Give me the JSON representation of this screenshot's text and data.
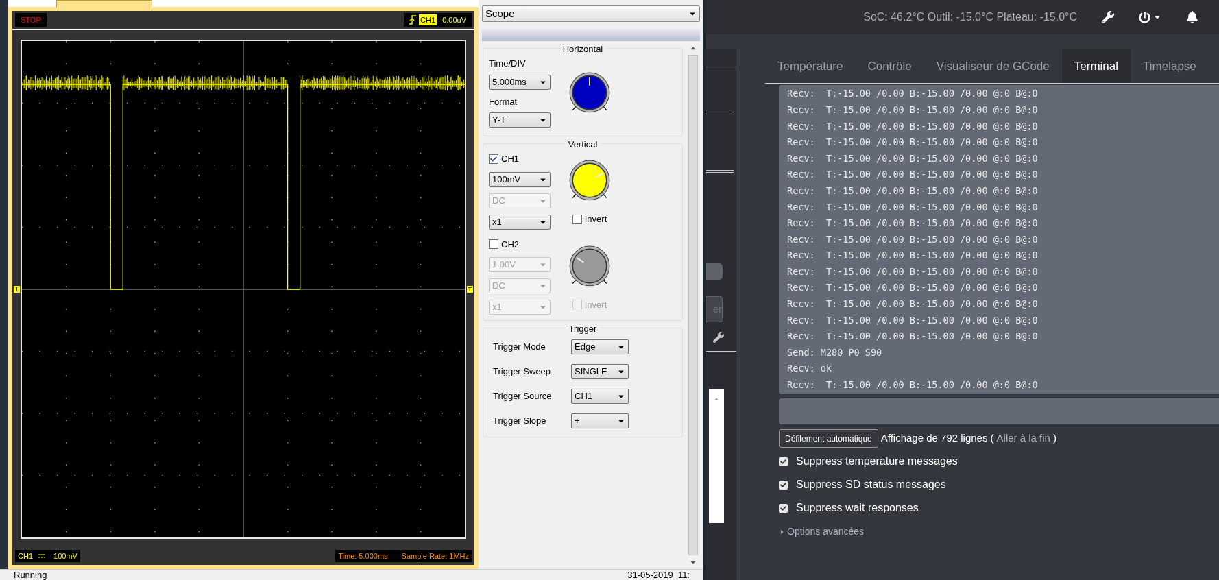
{
  "scope": {
    "status": "STOP",
    "trigger_channel": "CH1",
    "trigger_level": "0.00uV",
    "ground_marker": "1",
    "trigger_marker": "T",
    "footer_channel": "CH1",
    "footer_scale": "100mV",
    "time": "Time: 5.000ms",
    "sample_rate": "Sample Rate: 1MHz"
  },
  "panel": {
    "mode": "Scope",
    "horizontal": {
      "title": "Horizontal",
      "fields": [
        {
          "label": "Time/DIV",
          "value": "5.000ms"
        },
        {
          "label": "Format",
          "value": "Y-T"
        }
      ],
      "knob": {
        "color": "#0000c0"
      }
    },
    "vertical": {
      "title": "Vertical",
      "channels": [
        {
          "name": "CH1",
          "checked": true,
          "scale": "100mV",
          "coupling": "DC",
          "coupling_disabled": true,
          "probe": "x1",
          "invert": "Invert",
          "invert_checked": false,
          "knob": {
            "color": "#ffff00"
          }
        },
        {
          "name": "CH2",
          "checked": false,
          "scale": "1.00V",
          "coupling": "DC",
          "coupling_disabled": true,
          "probe": "x1",
          "invert": "Invert",
          "invert_checked": false,
          "knob": {
            "color": "#9a9a9a"
          }
        }
      ]
    },
    "trigger": {
      "title": "Trigger",
      "rows": [
        {
          "label": "Trigger Mode",
          "value": "Edge"
        },
        {
          "label": "Trigger Sweep",
          "value": "SINGLE"
        },
        {
          "label": "Trigger Source",
          "value": "CH1"
        },
        {
          "label": "Trigger Slope",
          "value": "+"
        }
      ]
    }
  },
  "status_bar": {
    "left": "Running",
    "right": "31-05-2019  11:"
  },
  "navbar": {
    "temperatures": "SoC: 46.2°C Outil: -15.0°C Plateau: -15.0°C"
  },
  "sidebar": {
    "button_fragment": "er"
  },
  "tabs": [
    {
      "label": "Température",
      "selected": false
    },
    {
      "label": "Contrôle",
      "selected": false
    },
    {
      "label": "Visualiseur de GCode",
      "selected": false
    },
    {
      "label": "Terminal",
      "selected": true
    },
    {
      "label": "Timelapse",
      "selected": false
    }
  ],
  "terminal": {
    "lines": [
      "Recv:  T:-15.00 /0.00 B:-15.00 /0.00 @:0 B@:0",
      "Recv:  T:-15.00 /0.00 B:-15.00 /0.00 @:0 B@:0",
      "Recv:  T:-15.00 /0.00 B:-15.00 /0.00 @:0 B@:0",
      "Recv:  T:-15.00 /0.00 B:-15.00 /0.00 @:0 B@:0",
      "Recv:  T:-15.00 /0.00 B:-15.00 /0.00 @:0 B@:0",
      "Recv:  T:-15.00 /0.00 B:-15.00 /0.00 @:0 B@:0",
      "Recv:  T:-15.00 /0.00 B:-15.00 /0.00 @:0 B@:0",
      "Recv:  T:-15.00 /0.00 B:-15.00 /0.00 @:0 B@:0",
      "Recv:  T:-15.00 /0.00 B:-15.00 /0.00 @:0 B@:0",
      "Recv:  T:-15.00 /0.00 B:-15.00 /0.00 @:0 B@:0",
      "Recv:  T:-15.00 /0.00 B:-15.00 /0.00 @:0 B@:0",
      "Recv:  T:-15.00 /0.00 B:-15.00 /0.00 @:0 B@:0",
      "Recv:  T:-15.00 /0.00 B:-15.00 /0.00 @:0 B@:0",
      "Recv:  T:-15.00 /0.00 B:-15.00 /0.00 @:0 B@:0",
      "Recv:  T:-15.00 /0.00 B:-15.00 /0.00 @:0 B@:0",
      "Recv:  T:-15.00 /0.00 B:-15.00 /0.00 @:0 B@:0",
      "Send: M280 P0 S90",
      "Recv: ok",
      "Recv:  T:-15.00 /0.00 B:-15.00 /0.00 @:0 B@:0"
    ]
  },
  "autoscroll_button": "Défilement automatique",
  "line_count": "Affichage de 792 lignes (",
  "scroll_link": "Aller à la fin",
  "line_count_end": ")",
  "options": [
    {
      "label": "Suppress temperature messages",
      "checked": true
    },
    {
      "label": "Suppress SD status messages",
      "checked": true
    },
    {
      "label": "Suppress wait responses",
      "checked": true
    }
  ],
  "advanced": {
    "label": "Options avancées",
    "expanded": false
  }
}
